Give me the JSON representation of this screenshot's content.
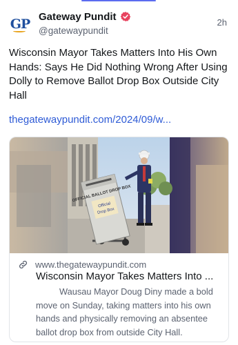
{
  "post": {
    "author": {
      "display_name": "Gateway Pundit",
      "handle": "@gatewaypundit",
      "avatar_text": "GP",
      "verified": true
    },
    "timestamp": "2h",
    "text": "Wisconsin Mayor Takes Matters Into His Own Hands: Says He Did Nothing Wrong After Using Dolly to Remove Ballot Drop Box Outside City Hall",
    "link_text": "thegatewaypundit.com/2024/09/w..."
  },
  "card": {
    "domain": "www.thegatewaypundit.com",
    "title": "Wisconsin Mayor Takes Matters Into ...",
    "description": "Wausau Mayor Doug Diny made a bold move on Sunday, taking matters into his own hands and physically removing an absentee ballot drop box from outside City Hall.",
    "image": {
      "box_text": "OFFICIAL BALLOT DROP BOX",
      "sign_text_1": "Official",
      "sign_text_2": "Drop Box"
    }
  },
  "colors": {
    "link": "#2e5bd6",
    "verified_badge": "#e8435f",
    "text_primary": "#14171a",
    "text_secondary": "#5b6270"
  },
  "icons": {
    "verified": "verified-badge-icon",
    "link": "link-icon"
  }
}
